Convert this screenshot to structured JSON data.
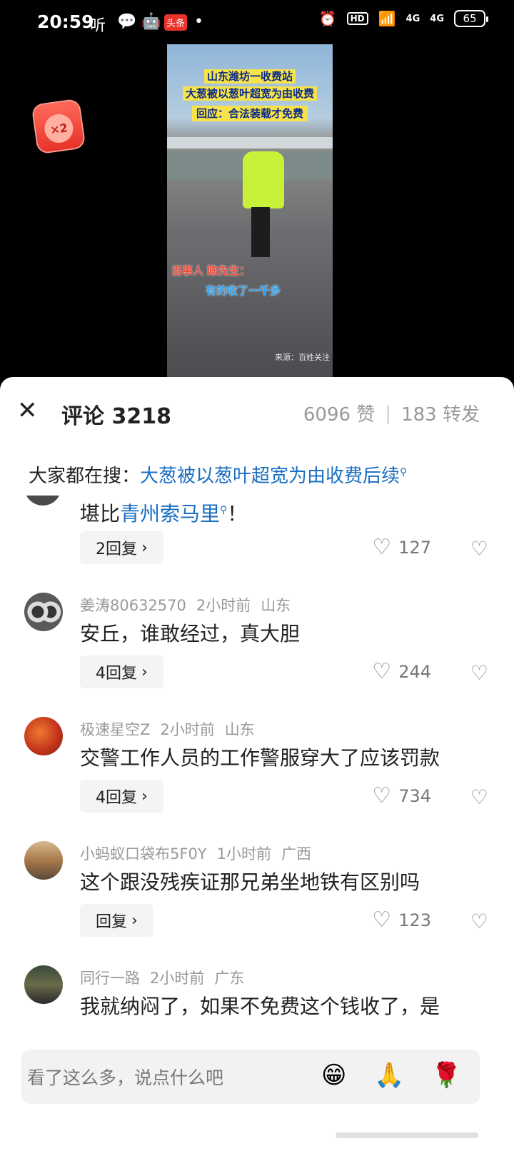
{
  "status_bar": {
    "time": "20:59",
    "app_badge": "头条",
    "listen": "听",
    "battery": "65",
    "hd": "HD",
    "net1": "4G",
    "net2": "4G"
  },
  "video": {
    "title_line1": "山东潍坊一收费站",
    "title_line2": "大葱被以葱叶超宽为由收费",
    "reply_line": "回应：合法装载才免费",
    "person_label": "当事人 陈先生：",
    "quote": "有的收了一千多",
    "source": "来源：百姓关注"
  },
  "red_packet": {
    "label": "×2"
  },
  "header": {
    "title": "评论 3218",
    "likes": "6096 赞",
    "forwards": "183 转发"
  },
  "search": {
    "prefix": "大家都在搜：",
    "query": "大葱被以葱叶超宽为由收费后续"
  },
  "first_comment": {
    "text_prefix": "堪比",
    "link": "青州索马里",
    "text_suffix": "！",
    "reply_label": "2回复",
    "likes": "127"
  },
  "comments": [
    {
      "user": "姜涛80632570",
      "time": "2小时前",
      "location": "山东",
      "text": "安丘，谁敢经过，真大胆",
      "reply_label": "4回复",
      "likes": "244"
    },
    {
      "user": "极速星空Z",
      "time": "2小时前",
      "location": "山东",
      "text": "交警工作人员的工作警服穿大了应该罚款",
      "reply_label": "4回复",
      "likes": "734"
    },
    {
      "user": "小蚂蚁口袋布5F0Y",
      "time": "1小时前",
      "location": "广西",
      "text": "这个跟没残疾证那兄弟坐地铁有区别吗",
      "reply_label": "回复",
      "likes": "123"
    },
    {
      "user": "同行一路",
      "time": "2小时前",
      "location": "广东",
      "text": "我就纳闷了，如果不免费这个钱收了，是"
    }
  ],
  "input": {
    "placeholder": "看了这么多，说点什么吧"
  },
  "emojis": [
    "😁",
    "🙏",
    "🌹"
  ],
  "colors": {
    "link": "#1b6ec2",
    "sheet_bg": "#ffffff",
    "video_caption_bg": "#f6e24a"
  }
}
